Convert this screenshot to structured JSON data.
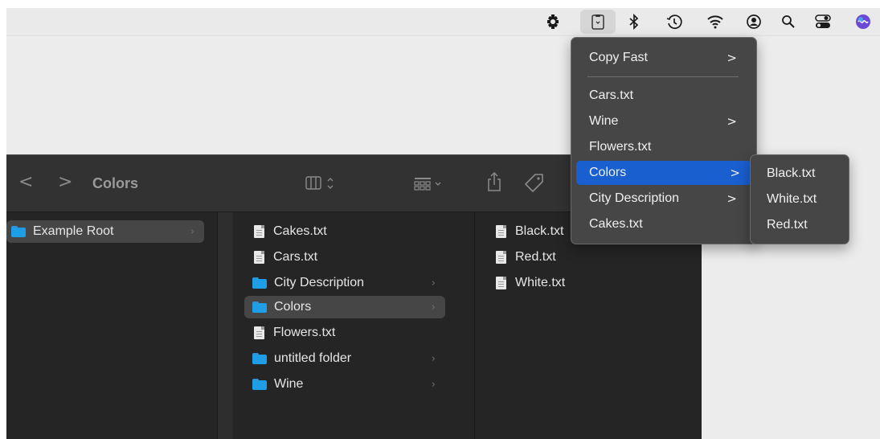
{
  "menubar": {
    "icons": [
      "puzzle-gear-icon",
      "clipboard-icon",
      "bluetooth-icon",
      "time-machine-icon",
      "wifi-icon",
      "user-icon",
      "search-icon",
      "control-center-icon",
      "siri-icon"
    ]
  },
  "finder": {
    "title": "Colors",
    "back": "<",
    "forward": ">",
    "columns": {
      "root": [
        {
          "label": "Example Root",
          "type": "folder",
          "selected": true
        }
      ],
      "example_root": [
        {
          "label": "Cakes.txt",
          "type": "file"
        },
        {
          "label": "Cars.txt",
          "type": "file"
        },
        {
          "label": "City Description",
          "type": "folder"
        },
        {
          "label": "Colors",
          "type": "folder",
          "selected": true
        },
        {
          "label": "Flowers.txt",
          "type": "file"
        },
        {
          "label": "untitled folder",
          "type": "folder"
        },
        {
          "label": "Wine",
          "type": "folder"
        }
      ],
      "colors": [
        {
          "label": "Black.txt",
          "type": "file"
        },
        {
          "label": "Red.txt",
          "type": "file"
        },
        {
          "label": "White.txt",
          "type": "file"
        }
      ]
    }
  },
  "menu": {
    "items": [
      {
        "label": "Copy Fast",
        "submenu": true
      },
      {
        "label": "Cars.txt",
        "submenu": false
      },
      {
        "label": "Wine",
        "submenu": true
      },
      {
        "label": "Flowers.txt",
        "submenu": false
      },
      {
        "label": "Colors",
        "submenu": true,
        "highlighted": true
      },
      {
        "label": "City Description",
        "submenu": true
      },
      {
        "label": "Cakes.txt",
        "submenu": false
      }
    ],
    "arrow": ">"
  },
  "submenu": {
    "items": [
      {
        "label": "Black.txt"
      },
      {
        "label": "White.txt"
      },
      {
        "label": "Red.txt"
      }
    ]
  },
  "colors": {
    "menu_highlight": "#1a5fd0",
    "folder": "#1f9ee8",
    "finder_bg": "#2a2a2a"
  }
}
